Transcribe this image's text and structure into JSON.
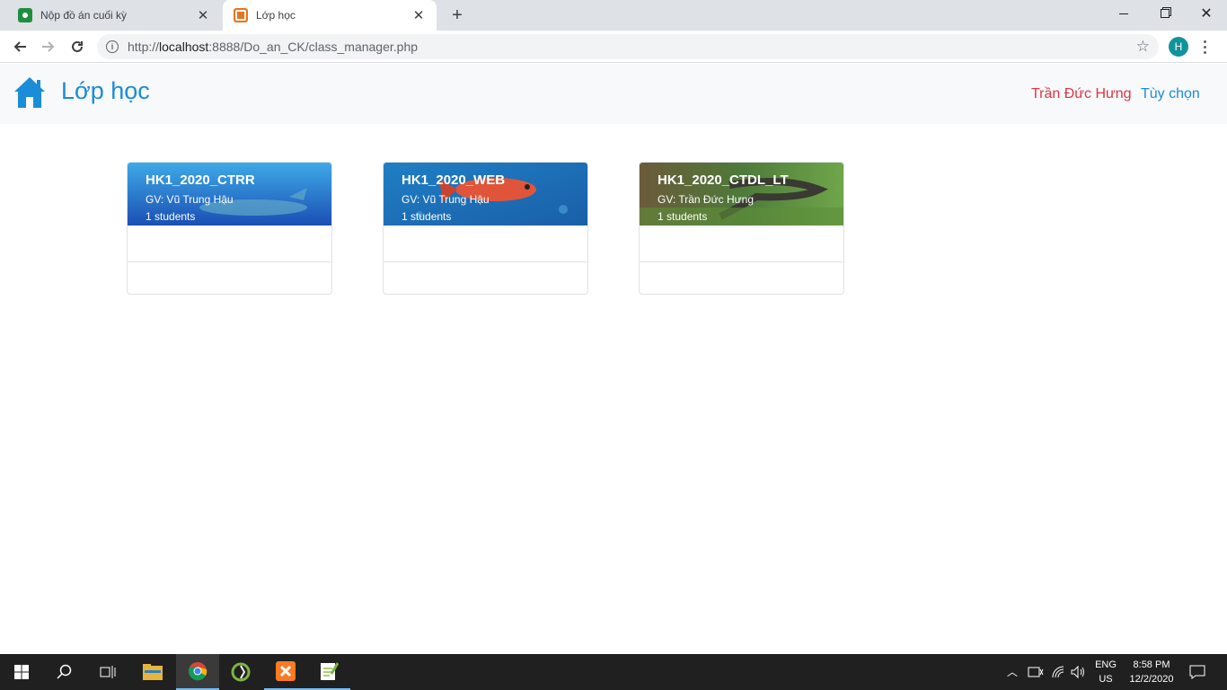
{
  "browser": {
    "tabs": [
      {
        "title": "Nộp đồ án cuối kỳ",
        "favicon": "google-classroom-icon"
      },
      {
        "title": "Lớp học",
        "favicon": "xampp-icon"
      }
    ],
    "url": {
      "scheme": "http://",
      "host": "localhost",
      "rest": ":8888/Do_an_CK/class_manager.php"
    },
    "profile_initial": "H"
  },
  "navbar": {
    "brand": "Lớp học",
    "user_name": "Trần Đức Hưng",
    "options_label": "Tùy chọn",
    "colors": {
      "brand": "#1a8cd8",
      "user": "#dc3545"
    }
  },
  "classes": [
    {
      "name": "HK1_2020_CTRR",
      "teacher": "GV: Vũ Trung Hậu",
      "students": "1 students",
      "banner": "whale-underwater"
    },
    {
      "name": "HK1_2020_WEB",
      "teacher": "GV: Vũ Trung Hậu",
      "students": "1 students",
      "banner": "red-fish-underwater"
    },
    {
      "name": "HK1_2020_CTDL_LT",
      "teacher": "GV: Trần Đức Hưng",
      "students": "1 students",
      "banner": "lizard-grass"
    }
  ],
  "taskbar": {
    "apps": [
      "start",
      "search",
      "task-view",
      "file-explorer",
      "chrome",
      "coccoc",
      "xampp",
      "notepad-plus-plus"
    ],
    "language": {
      "line1": "ENG",
      "line2": "US"
    },
    "clock": {
      "time": "8:58 PM",
      "date": "12/2/2020"
    }
  }
}
